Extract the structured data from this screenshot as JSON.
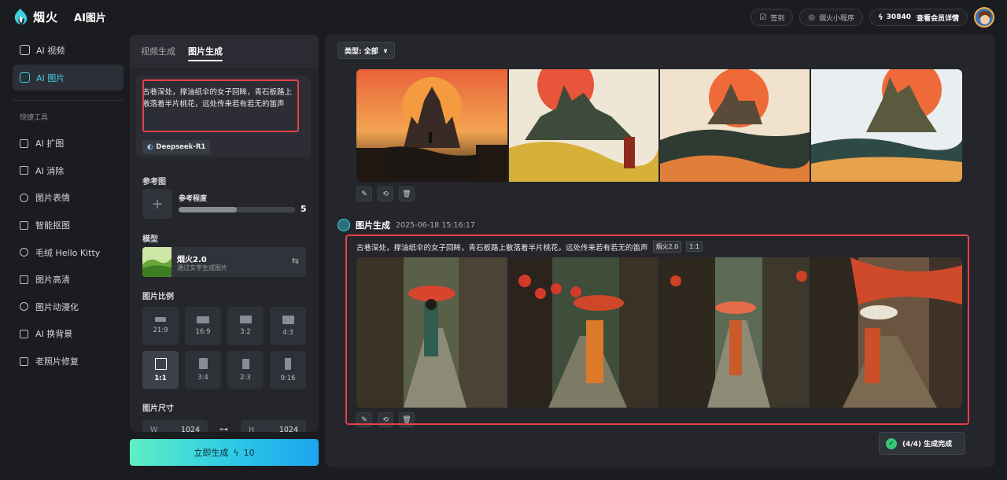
{
  "header": {
    "brand": "烟火",
    "product": "AI图片",
    "checkin": "签到",
    "miniprogram": "烟火小程序",
    "points": "30840",
    "member": "查看会员详情"
  },
  "sidebar": {
    "main": [
      {
        "label": "AI 视频"
      },
      {
        "label": "AI 图片"
      }
    ],
    "tools_title": "快捷工具",
    "tools": [
      {
        "label": "AI 扩图"
      },
      {
        "label": "AI 消除"
      },
      {
        "label": "图片表情"
      },
      {
        "label": "智能抠图"
      },
      {
        "label": "毛绒 Hello Kitty"
      },
      {
        "label": "图片高清"
      },
      {
        "label": "图片动漫化"
      },
      {
        "label": "AI 换背景"
      },
      {
        "label": "老照片修复"
      }
    ]
  },
  "panel": {
    "tabs": [
      "视频生成",
      "图片生成"
    ],
    "prompt": "古巷深处，撑油纸伞的女子回眸，青石板路上散落着半片桃花，远处传来若有若无的笛声",
    "llm_chip": "Deepseek-R1",
    "ref_title": "参考图",
    "ref_add": "+",
    "ref_strength_label": "参考程度",
    "ref_strength_value": "5",
    "ref_strength_fraction": 0.5,
    "model_title": "模型",
    "model_name": "烟火2.0",
    "model_desc": "通过文字生成图片",
    "ratio_title": "图片比例",
    "ratios": [
      "21:9",
      "16:9",
      "3:2",
      "4:3",
      "1:1",
      "3:4",
      "2:3",
      "9:16"
    ],
    "selected_ratio": "1:1",
    "size_title": "图片尺寸",
    "width_key": "W",
    "width_value": "1024",
    "height_key": "H",
    "height_value": "1024",
    "generate_label": "立即生成",
    "generate_cost": "10"
  },
  "content": {
    "type_filter": "类型: 全部",
    "gen_title": "图片生成",
    "gen_time": "2025-06-18 15:16:17",
    "result_prompt": "古巷深处，撑油纸伞的女子回眸，青石板路上散落着半片桃花，远处传来若有若无的笛声",
    "result_model_tag": "烟火2.0",
    "result_ratio_tag": "1:1",
    "status": "(4/4) 生成完成"
  },
  "colors": {
    "accent": "#3fd0e3",
    "highlight": "#e5414a",
    "success": "#37c87a"
  },
  "icons": {
    "edit": "pencil-icon",
    "regenerate": "refresh-icon",
    "delete": "trash-icon"
  }
}
